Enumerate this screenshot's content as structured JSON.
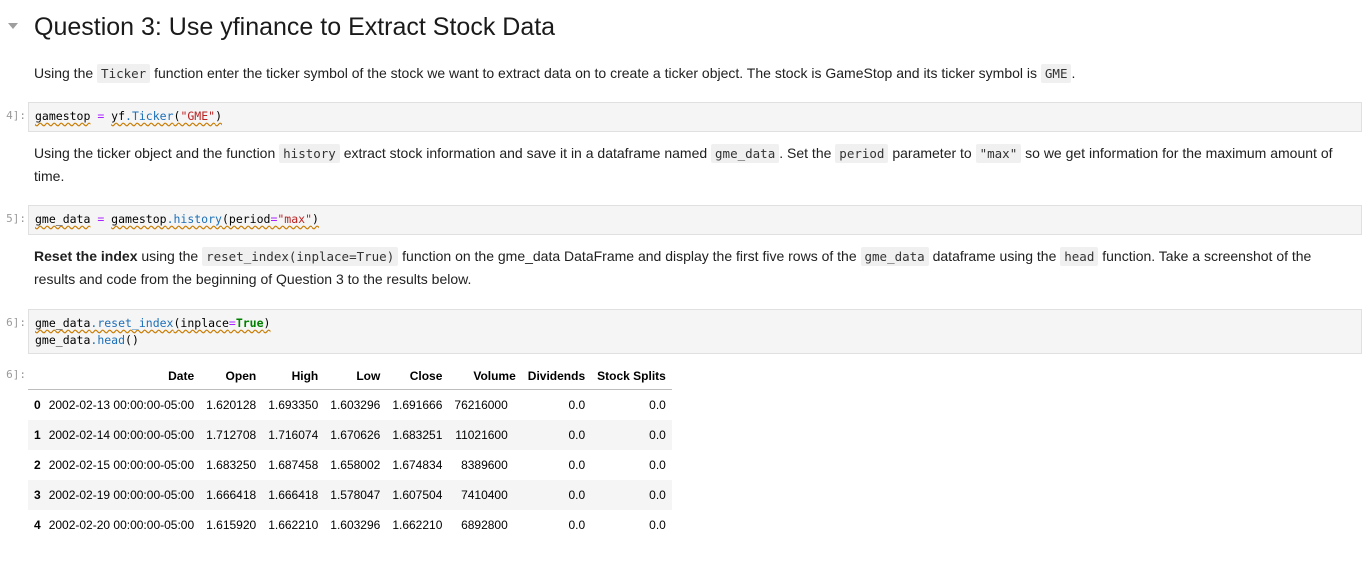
{
  "heading": "Question 3: Use yfinance to Extract Stock Data",
  "md1": {
    "t1": "Using the ",
    "c1": "Ticker",
    "t2": " function enter the ticker symbol of the stock we want to extract data on to create a ticker object. The stock is GameStop and its ticker symbol is ",
    "c2": "GME",
    "t3": "."
  },
  "cell1": {
    "prompt": "4]:",
    "var": "gamestop",
    "op": " = ",
    "mod": "yf",
    "attr": ".Ticker",
    "open": "(",
    "str": "\"GME\"",
    "close": ")"
  },
  "md2": {
    "t1": "Using the ticker object and the function ",
    "c1": "history",
    "t2": " extract stock information and save it in a dataframe named ",
    "c2": "gme_data",
    "t3": ". Set the ",
    "c3": "period",
    "t4": " parameter to ",
    "c4": "\"max\"",
    "t5": " so we get information for the maximum amount of time."
  },
  "cell2": {
    "prompt": "5]:",
    "var": "gme_data",
    "op": " = ",
    "obj": "gamestop",
    "attr": ".history",
    "open": "(",
    "kwarg": "period",
    "eq": "=",
    "str": "\"max\"",
    "close": ")"
  },
  "md3": {
    "bold": "Reset the index",
    "t1": " using the ",
    "c1": "reset_index(inplace=True)",
    "t2": " function on the gme_data DataFrame and display the first five rows of the ",
    "c2": "gme_data",
    "t3": " dataframe using the ",
    "c3": "head",
    "t4": " function. Take a screenshot of the results and code from the beginning of Question 3 to the results below."
  },
  "cell3": {
    "prompt": "6]:",
    "l1_obj": "gme_data",
    "l1_attr": ".reset_index",
    "l1_open": "(",
    "l1_kwarg": "inplace",
    "l1_eq": "=",
    "l1_kw": "True",
    "l1_close": ")",
    "l2_obj": "gme_data",
    "l2_attr": ".head",
    "l2_call": "()"
  },
  "output": {
    "prompt": "6]:",
    "columns": [
      "",
      "Date",
      "Open",
      "High",
      "Low",
      "Close",
      "Volume",
      "Dividends",
      "Stock Splits"
    ],
    "rows": [
      [
        "0",
        "2002-02-13 00:00:00-05:00",
        "1.620128",
        "1.693350",
        "1.603296",
        "1.691666",
        "76216000",
        "0.0",
        "0.0"
      ],
      [
        "1",
        "2002-02-14 00:00:00-05:00",
        "1.712708",
        "1.716074",
        "1.670626",
        "1.683251",
        "11021600",
        "0.0",
        "0.0"
      ],
      [
        "2",
        "2002-02-15 00:00:00-05:00",
        "1.683250",
        "1.687458",
        "1.658002",
        "1.674834",
        "8389600",
        "0.0",
        "0.0"
      ],
      [
        "3",
        "2002-02-19 00:00:00-05:00",
        "1.666418",
        "1.666418",
        "1.578047",
        "1.607504",
        "7410400",
        "0.0",
        "0.0"
      ],
      [
        "4",
        "2002-02-20 00:00:00-05:00",
        "1.615920",
        "1.662210",
        "1.603296",
        "1.662210",
        "6892800",
        "0.0",
        "0.0"
      ]
    ]
  },
  "icons": {
    "collapse": "chevron-down-icon"
  },
  "colors": {
    "string": "#ba2121",
    "operator": "#aa22ff",
    "attribute": "#1c6fb8",
    "keyword": "#008000",
    "cell_bg": "#f5f5f5"
  }
}
